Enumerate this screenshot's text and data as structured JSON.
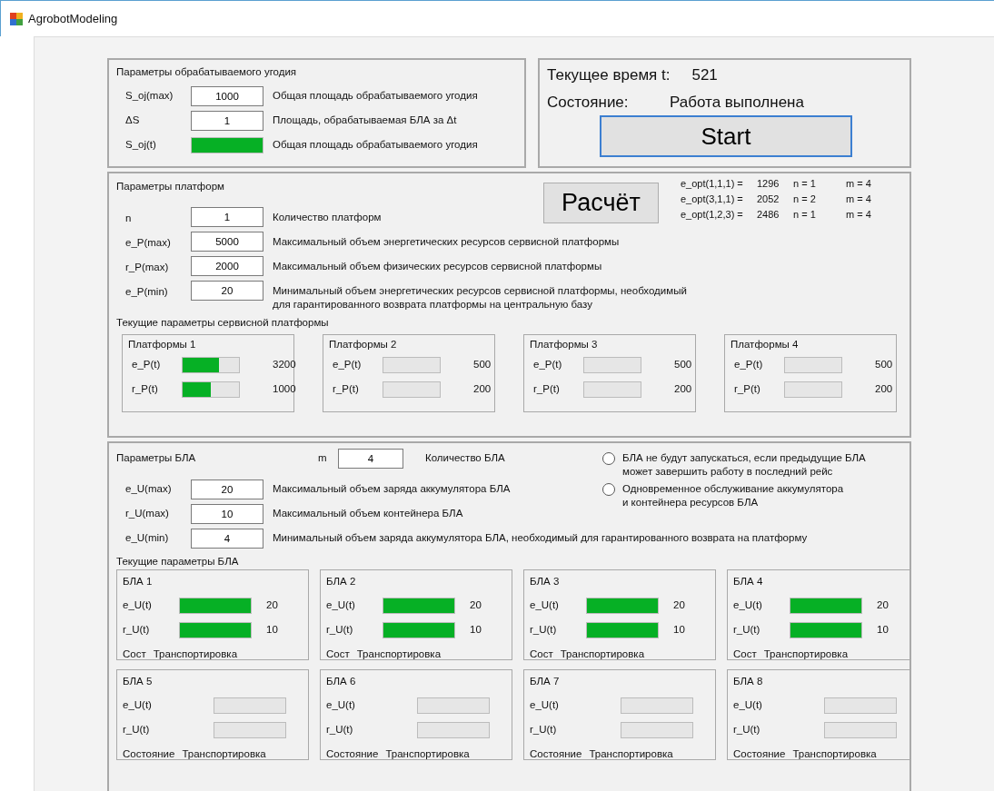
{
  "window": {
    "title": "AgrobotModeling"
  },
  "field_panel": {
    "title": "Параметры обрабатываемого угодия",
    "params": [
      {
        "kind": "input",
        "label": "S_oj(max)",
        "value": "1000",
        "description": "Общая площадь обрабатываемого угодия"
      },
      {
        "kind": "input",
        "label": "ΔS",
        "value": "1",
        "description": "Площадь, обрабатываемая БЛА за Δt"
      },
      {
        "kind": "bar",
        "label": "S_oj(t)",
        "level": 1,
        "description": "Общая площадь обрабатываемого угодия"
      }
    ]
  },
  "status_panel": {
    "time_label": "Текущее время t:",
    "time_value": "521",
    "state_label": "Состояние:",
    "state_value": "Работа выполнена",
    "start_button": "Start"
  },
  "platform_panel": {
    "title": "Параметры платформ",
    "calc_button": "Расчёт",
    "results": [
      [
        "e_opt(1,1,1) =",
        "1296",
        "n =  1",
        "m =  4"
      ],
      [
        "e_opt(3,1,1) =",
        "2052",
        "n =  2",
        "m =  4"
      ],
      [
        "e_opt(1,2,3) =",
        "2486",
        "n =  1",
        "m =  4"
      ]
    ],
    "params": [
      {
        "label": "n",
        "value": "1",
        "description": "Количество платформ"
      },
      {
        "label": "e_P(max)",
        "value": "5000",
        "description": "Максимальный объем энергетических ресурсов сервисной платформы"
      },
      {
        "label": "r_P(max)",
        "value": "2000",
        "description": "Максимальный объем физических ресурсов сервисной платформы"
      },
      {
        "label": "e_P(min)",
        "value": "20",
        "description": "Минимальный объем энергетических ресурсов сервисной платформы, необходимый\nдля гарантированного возврата платформы на центральную базу"
      }
    ],
    "current_title": "Текущие параметры сервисной платформы",
    "platforms": [
      {
        "title": "Платформы 1",
        "rows": [
          {
            "label": "e_P(t)",
            "level": 0.64,
            "reading": "3200"
          },
          {
            "label": "r_P(t)",
            "level": 0.5,
            "reading": "1000"
          }
        ]
      },
      {
        "title": "Платформы 2",
        "rows": [
          {
            "label": "e_P(t)",
            "level": 0,
            "reading": "500"
          },
          {
            "label": "r_P(t)",
            "level": 0,
            "reading": "200"
          }
        ]
      },
      {
        "title": "Платформы 3",
        "rows": [
          {
            "label": "e_P(t)",
            "level": 0,
            "reading": "500"
          },
          {
            "label": "r_P(t)",
            "level": 0,
            "reading": "200"
          }
        ]
      },
      {
        "title": "Платформы 4",
        "rows": [
          {
            "label": "e_P(t)",
            "level": 0,
            "reading": "500"
          },
          {
            "label": "r_P(t)",
            "level": 0,
            "reading": "200"
          }
        ]
      }
    ]
  },
  "uav_panel": {
    "title": "Параметры БЛА",
    "m_label": "m",
    "m_value": "4",
    "m_description": "Количество БЛА",
    "params": [
      {
        "label": "e_U(max)",
        "value": "20",
        "description": "Максимальный объем заряда аккумулятора БЛА"
      },
      {
        "label": "r_U(max)",
        "value": "10",
        "description": "Максимальный объем контейнера БЛА"
      },
      {
        "label": "e_U(min)",
        "value": "4",
        "description": "Минимальный объем заряда аккумулятора БЛА, необходимый для гарантированного возврата на платформу"
      }
    ],
    "options": [
      {
        "label": "БЛА не будут запускаться, если предыдущие БЛА\nможет завершить работу в последний рейс",
        "selected": false
      },
      {
        "label": "Одновременное обслуживание аккумулятора\nи контейнера ресурсов БЛА",
        "selected": false
      }
    ],
    "current_title": "Текущие параметры БЛА",
    "uavs": [
      {
        "title": "БЛА 1",
        "rows": [
          {
            "label": "e_U(t)",
            "level": 1,
            "reading": "20"
          },
          {
            "label": "r_U(t)",
            "level": 1,
            "reading": "10"
          }
        ],
        "state_label": "Сост",
        "state_value": "Транспортировка"
      },
      {
        "title": "БЛА 2",
        "rows": [
          {
            "label": "e_U(t)",
            "level": 1,
            "reading": "20"
          },
          {
            "label": "r_U(t)",
            "level": 1,
            "reading": "10"
          }
        ],
        "state_label": "Сост",
        "state_value": "Транспортировка"
      },
      {
        "title": "БЛА 3",
        "rows": [
          {
            "label": "e_U(t)",
            "level": 1,
            "reading": "20"
          },
          {
            "label": "r_U(t)",
            "level": 1,
            "reading": "10"
          }
        ],
        "state_label": "Сост",
        "state_value": "Транспортировка"
      },
      {
        "title": "БЛА 4",
        "rows": [
          {
            "label": "e_U(t)",
            "level": 1,
            "reading": "20"
          },
          {
            "label": "r_U(t)",
            "level": 1,
            "reading": "10"
          }
        ],
        "state_label": "Сост",
        "state_value": "Транспортировка"
      },
      {
        "title": "БЛА 5",
        "rows": [
          {
            "label": "e_U(t)",
            "level": 0
          },
          {
            "label": "r_U(t)",
            "level": 0
          }
        ],
        "state_label": "Состояние",
        "state_value": "Транспортировка"
      },
      {
        "title": "БЛА 6",
        "rows": [
          {
            "label": "e_U(t)",
            "level": 0
          },
          {
            "label": "r_U(t)",
            "level": 0
          }
        ],
        "state_label": "Состояние",
        "state_value": "Транспортировка"
      },
      {
        "title": "БЛА 7",
        "rows": [
          {
            "label": "e_U(t)",
            "level": 0
          },
          {
            "label": "r_U(t)",
            "level": 0
          }
        ],
        "state_label": "Состояние",
        "state_value": "Транспортировка"
      },
      {
        "title": "БЛА 8",
        "rows": [
          {
            "label": "e_U(t)",
            "level": 0
          },
          {
            "label": "r_U(t)",
            "level": 0
          }
        ],
        "state_label": "Состояние",
        "state_value": "Транспортировка"
      }
    ]
  }
}
